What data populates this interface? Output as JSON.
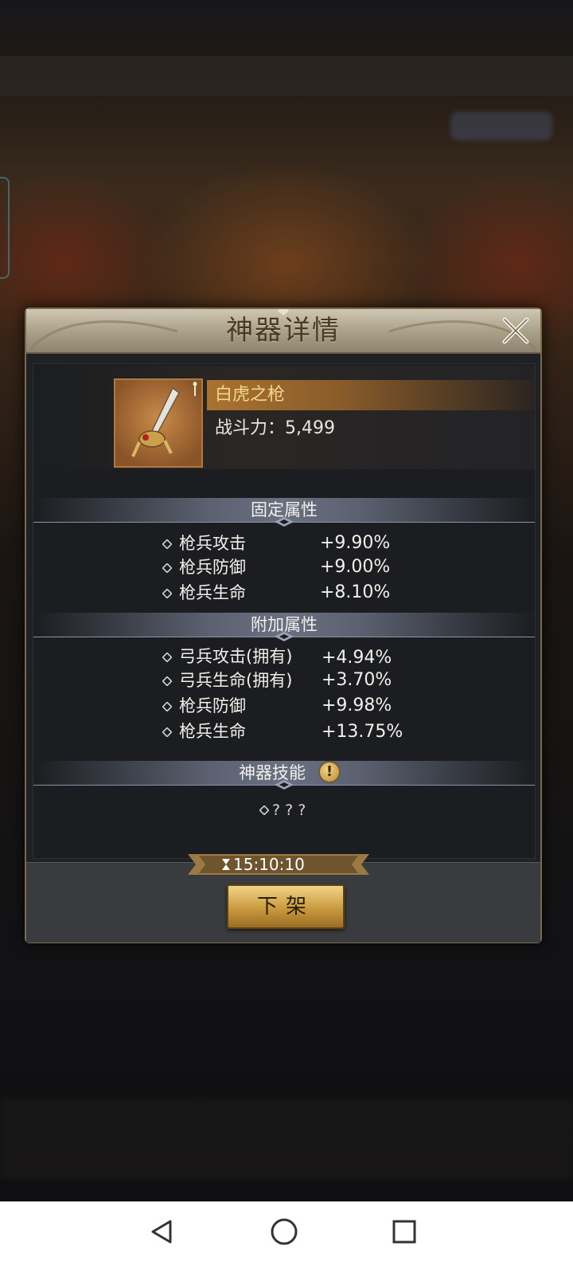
{
  "dialog": {
    "title": "神器详情",
    "item": {
      "name": "白虎之枪",
      "power_label": "战斗力：",
      "power_value": "5,499"
    },
    "fixed_attrs": {
      "title": "固定属性",
      "rows": [
        {
          "label": "枪兵攻击",
          "value": "+9.90%"
        },
        {
          "label": "枪兵防御",
          "value": "+9.00%"
        },
        {
          "label": "枪兵生命",
          "value": "+8.10%"
        }
      ]
    },
    "extra_attrs": {
      "title": "附加属性",
      "rows": [
        {
          "label": "弓兵攻击(拥有)",
          "value": "+4.94%"
        },
        {
          "label": "弓兵生命(拥有)",
          "value": "+3.70%"
        },
        {
          "label": "枪兵防御",
          "value": "+9.98%"
        },
        {
          "label": "枪兵生命",
          "value": "+13.75%"
        }
      ]
    },
    "skill": {
      "title": "神器技能",
      "badge": "!",
      "text": "? ? ?"
    },
    "timer": "15:10:10",
    "action_button": "下架"
  },
  "colors": {
    "accent_gold": "#c99a3f",
    "item_name": "#f4d78a",
    "panel": "#1f2124"
  },
  "icons": [
    "close-icon",
    "diamond-bullet-icon",
    "hourglass-icon",
    "exclamation-icon",
    "nav-back-icon",
    "nav-home-icon",
    "nav-recent-icon"
  ]
}
